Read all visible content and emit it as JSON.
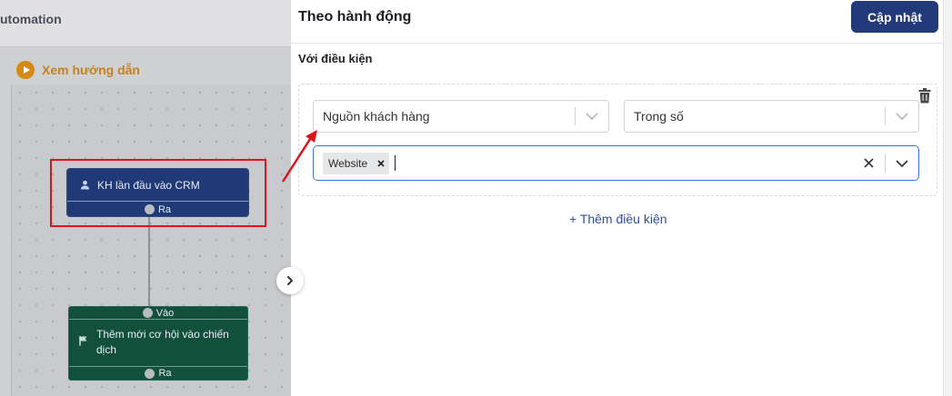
{
  "workflow": {
    "title": "utomation",
    "guide_label": "Xem hướng dẫn",
    "trigger_node": {
      "label": "KH lần đầu vào CRM",
      "out_label": "Ra"
    },
    "action_node": {
      "in_label": "Vào",
      "label": "Thêm mới cơ hội vào chiến dịch",
      "out_label": "Ra"
    }
  },
  "panel": {
    "title": "Theo hành động",
    "update_label": "Cập nhật",
    "section_label": "Với điều kiện",
    "condition": {
      "field": "Nguồn khách hàng",
      "operator": "Trong số",
      "values": [
        "Website"
      ]
    },
    "add_condition_label": "+ Thêm điều kiện"
  },
  "colors": {
    "primary": "#22397a",
    "trigger_node": "#1f3a77",
    "action_node": "#12503c",
    "highlight": "#e0131a",
    "guide": "#d58a12",
    "focus_border": "#3e73d6"
  }
}
